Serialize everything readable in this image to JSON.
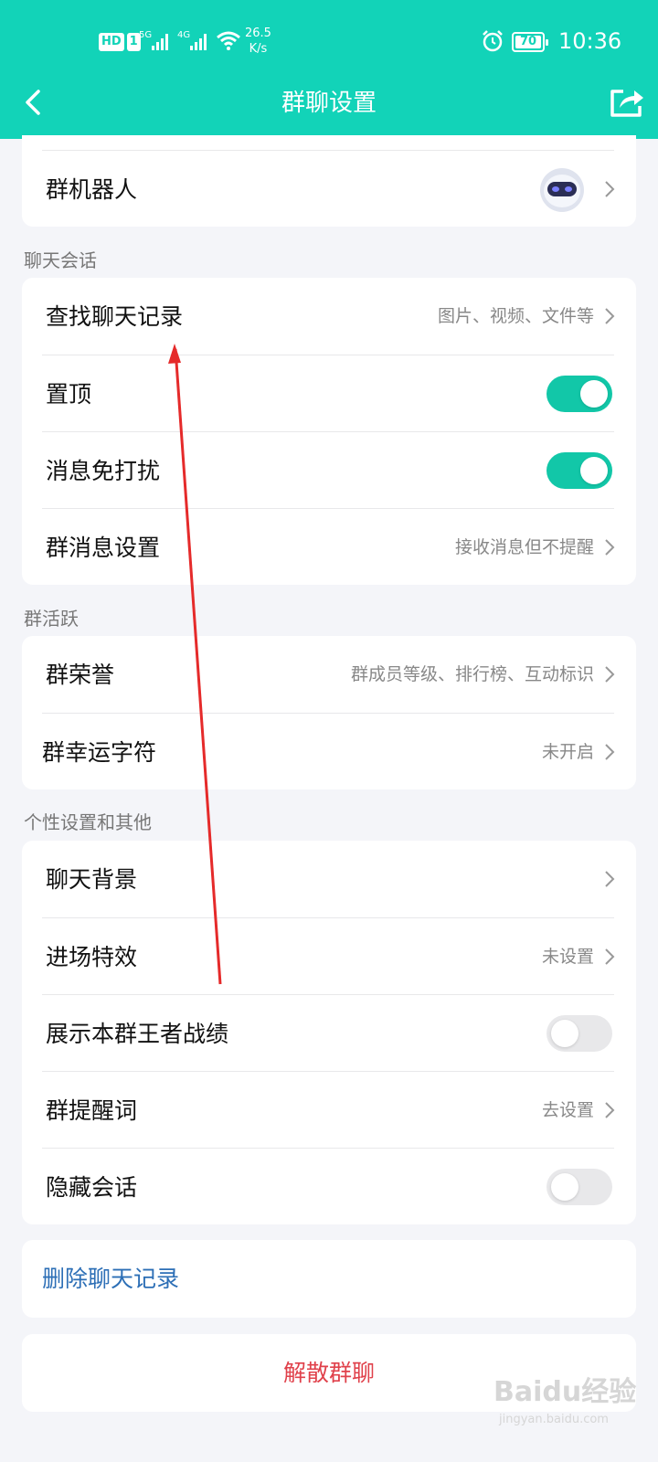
{
  "status_bar": {
    "hd_badge": "HD",
    "sim_badge": "1",
    "net1": "5G",
    "net2": "4G",
    "speed_value": "26.5",
    "speed_unit": "K/s",
    "battery": "70",
    "time": "10:36"
  },
  "nav": {
    "title": "群聊设置",
    "back_icon": "chevron-left-icon",
    "share_icon": "share-icon"
  },
  "colors": {
    "accent": "#12d3b8",
    "toggle_on": "#12c7a8",
    "link": "#2d6fb6",
    "danger": "#e0414b"
  },
  "group_robot": {
    "label": "群机器人",
    "icon": "robot-avatar-icon"
  },
  "chat_section": {
    "title": "聊天会话",
    "items": [
      {
        "label": "查找聊天记录",
        "value": "图片、视频、文件等"
      },
      {
        "label": "置顶",
        "toggle": true
      },
      {
        "label": "消息免打扰",
        "toggle": true
      },
      {
        "label": "群消息设置",
        "value": "接收消息但不提醒"
      }
    ]
  },
  "activity_section": {
    "title": "群活跃",
    "items": [
      {
        "label": "群荣誉",
        "value": "群成员等级、排行榜、互动标识"
      },
      {
        "label": "群幸运字符",
        "value": "未开启"
      }
    ]
  },
  "personal_section": {
    "title": "个性设置和其他",
    "items": [
      {
        "label": "聊天背景",
        "value": ""
      },
      {
        "label": "进场特效",
        "value": "未设置"
      },
      {
        "label": "展示本群王者战绩",
        "toggle": false
      },
      {
        "label": "群提醒词",
        "value": "去设置"
      },
      {
        "label": "隐藏会话",
        "toggle": false
      }
    ]
  },
  "actions": {
    "clear_history": "删除聊天记录",
    "dissolve_group": "解散群聊"
  },
  "watermark": {
    "main": "Baidu经验",
    "sub": "jingyan.baidu.com"
  }
}
